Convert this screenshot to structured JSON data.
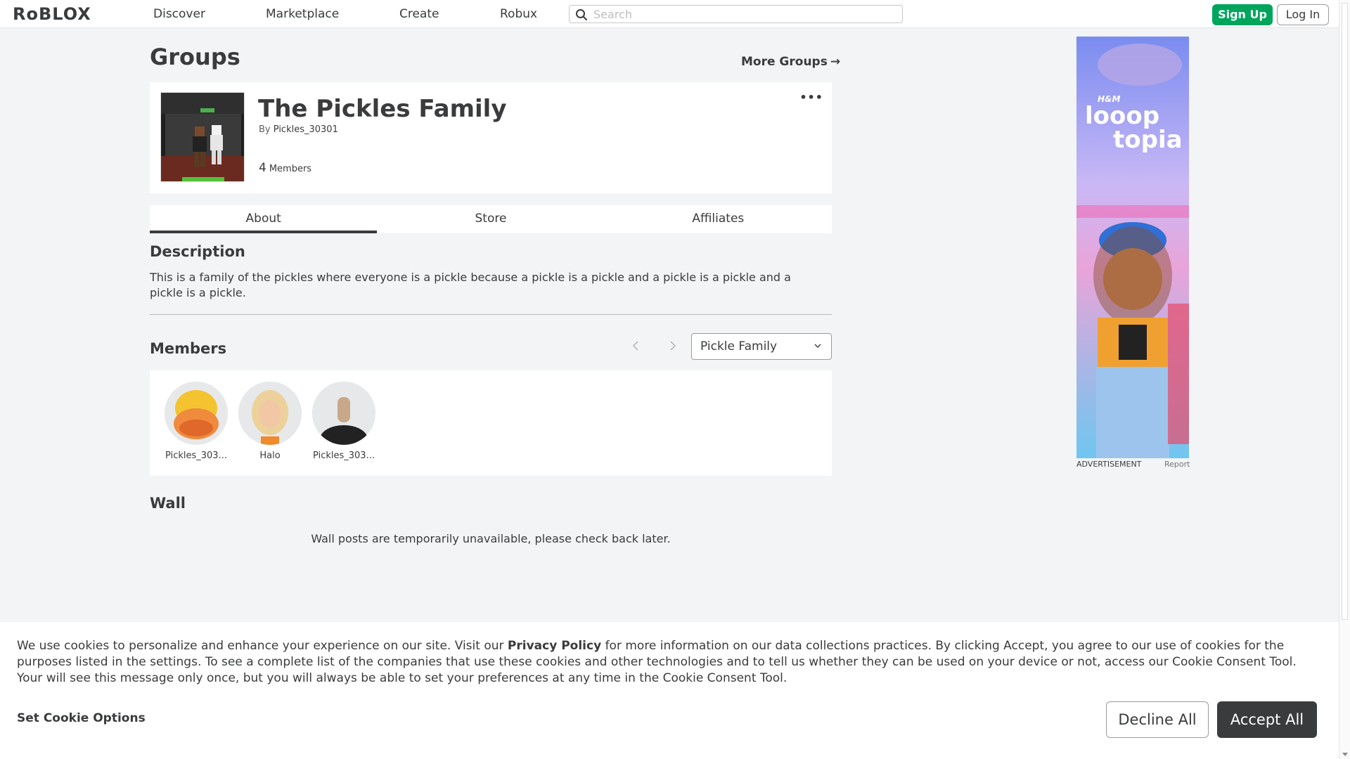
{
  "nav": {
    "logo": "RᴏBLOX",
    "links": [
      "Discover",
      "Marketplace",
      "Create",
      "Robux"
    ],
    "search_placeholder": "Search",
    "signup_label": "Sign Up",
    "login_label": "Log In"
  },
  "page": {
    "title": "Groups",
    "more_groups": "More Groups"
  },
  "group": {
    "name": "The Pickles Family",
    "by_label": "By",
    "owner": "Pickles_30301",
    "member_count": "4",
    "members_label": "Members",
    "menu_glyph": "•••"
  },
  "tabs": [
    "About",
    "Store",
    "Affiliates"
  ],
  "active_tab": "About",
  "description": {
    "heading": "Description",
    "text": "This is a family of the pickles where everyone is a pickle because a pickle is a pickle and a pickle is a pickle and a pickle is a pickle."
  },
  "members": {
    "heading": "Members",
    "role_selected": "Pickle Family",
    "list": [
      {
        "name": "Pickles_303..."
      },
      {
        "name": "Halo"
      },
      {
        "name": "Pickles_303..."
      }
    ]
  },
  "wall": {
    "heading": "Wall",
    "message": "Wall posts are temporarily unavailable, please check back later."
  },
  "ad": {
    "brand_small": "H&M",
    "brand_line1": "looop",
    "brand_line2": "topia",
    "label": "ADVERTISEMENT",
    "report": "Report"
  },
  "cookie": {
    "text_before": "We use cookies to personalize and enhance your experience on our site. Visit our ",
    "privacy_link": "Privacy Policy",
    "text_after": " for more information on our data collections practices. By clicking Accept, you agree to our use of cookies for the purposes listed in the settings. To see a complete list of the companies that use these cookies and other technologies and to tell us whether they can be used on your device or not, access our Cookie Consent Tool. Your will see this message only once, but you will always be able to set your preferences at any time in the Cookie Consent Tool.",
    "options_label": "Set Cookie Options",
    "decline_label": "Decline All",
    "accept_label": "Accept All"
  },
  "colors": {
    "accent_green": "#00a55c",
    "dark": "#393b3d",
    "background": "#f2f4f5"
  }
}
